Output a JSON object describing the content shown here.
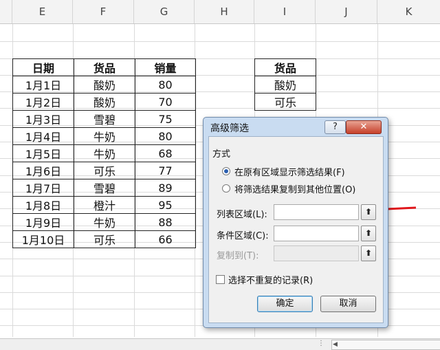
{
  "columns": [
    "E",
    "F",
    "G",
    "H",
    "I",
    "J",
    "K"
  ],
  "table_main": {
    "headers": [
      "日期",
      "货品",
      "销量"
    ],
    "rows": [
      [
        "1月1日",
        "酸奶",
        "80"
      ],
      [
        "1月2日",
        "酸奶",
        "70"
      ],
      [
        "1月3日",
        "雪碧",
        "75"
      ],
      [
        "1月4日",
        "牛奶",
        "80"
      ],
      [
        "1月5日",
        "牛奶",
        "68"
      ],
      [
        "1月6日",
        "可乐",
        "77"
      ],
      [
        "1月7日",
        "雪碧",
        "89"
      ],
      [
        "1月8日",
        "橙汁",
        "95"
      ],
      [
        "1月9日",
        "牛奶",
        "88"
      ],
      [
        "1月10日",
        "可乐",
        "66"
      ]
    ]
  },
  "table_criteria": {
    "header": "货品",
    "rows": [
      "酸奶",
      "可乐"
    ]
  },
  "dialog": {
    "title": "高级筛选",
    "help_label": "?",
    "close_label": "✕",
    "group_label": "方式",
    "option1_label": "在原有区域显示筛选结果(F)",
    "option2_label": "将筛选结果复制到其他位置(O)",
    "list_range_label": "列表区域(L):",
    "list_range_value": "",
    "criteria_range_label": "条件区域(C):",
    "criteria_range_value": "",
    "copy_to_label": "复制到(T):",
    "copy_to_value": "",
    "unique_label": "选择不重复的记录(R)",
    "ok_label": "确定",
    "cancel_label": "取消",
    "selected_option": 1
  },
  "colors": {
    "arrow": "#e0161b",
    "dialog_frame": "#c9dcf1"
  }
}
